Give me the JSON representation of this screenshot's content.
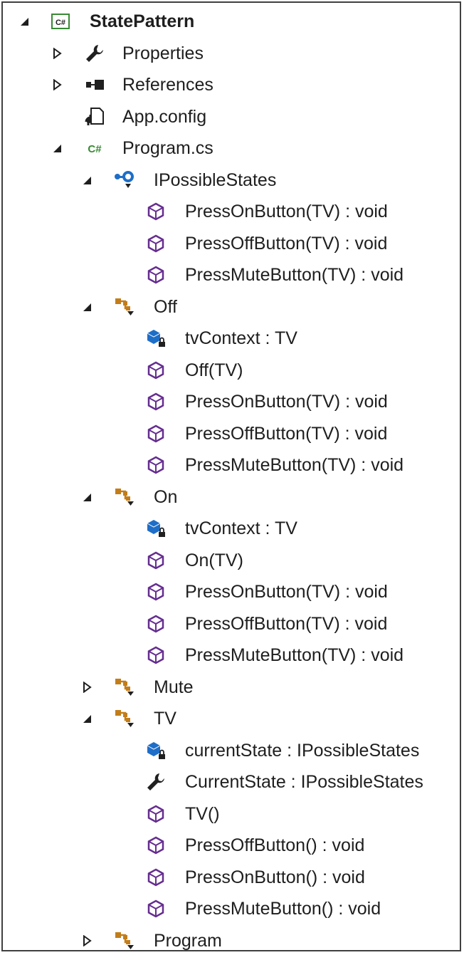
{
  "tree": {
    "rows": [
      {
        "depth": 0,
        "toggle": "expanded",
        "icon": "csharp-project-icon",
        "label": "StatePattern",
        "bold": true
      },
      {
        "depth": 1,
        "toggle": "collapsed",
        "icon": "wrench-icon",
        "label": "Properties"
      },
      {
        "depth": 1,
        "toggle": "collapsed",
        "icon": "references-icon",
        "label": "References"
      },
      {
        "depth": 1,
        "toggle": "none",
        "icon": "config-file-icon",
        "label": "App.config"
      },
      {
        "depth": 1,
        "toggle": "expanded",
        "icon": "csharp-file-icon",
        "label": "Program.cs"
      },
      {
        "depth": 2,
        "toggle": "expanded",
        "icon": "interface-icon",
        "label": "IPossibleStates"
      },
      {
        "depth": 3,
        "toggle": "none",
        "icon": "method-icon",
        "label": "PressOnButton(TV) : void"
      },
      {
        "depth": 3,
        "toggle": "none",
        "icon": "method-icon",
        "label": "PressOffButton(TV) : void"
      },
      {
        "depth": 3,
        "toggle": "none",
        "icon": "method-icon",
        "label": "PressMuteButton(TV) : void"
      },
      {
        "depth": 2,
        "toggle": "expanded",
        "icon": "class-icon",
        "label": "Off"
      },
      {
        "depth": 3,
        "toggle": "none",
        "icon": "private-field-icon",
        "label": "tvContext : TV"
      },
      {
        "depth": 3,
        "toggle": "none",
        "icon": "method-icon",
        "label": "Off(TV)"
      },
      {
        "depth": 3,
        "toggle": "none",
        "icon": "method-icon",
        "label": "PressOnButton(TV) : void"
      },
      {
        "depth": 3,
        "toggle": "none",
        "icon": "method-icon",
        "label": "PressOffButton(TV) : void"
      },
      {
        "depth": 3,
        "toggle": "none",
        "icon": "method-icon",
        "label": "PressMuteButton(TV) : void"
      },
      {
        "depth": 2,
        "toggle": "expanded",
        "icon": "class-icon",
        "label": "On"
      },
      {
        "depth": 3,
        "toggle": "none",
        "icon": "private-field-icon",
        "label": "tvContext : TV"
      },
      {
        "depth": 3,
        "toggle": "none",
        "icon": "method-icon",
        "label": "On(TV)"
      },
      {
        "depth": 3,
        "toggle": "none",
        "icon": "method-icon",
        "label": "PressOnButton(TV) : void"
      },
      {
        "depth": 3,
        "toggle": "none",
        "icon": "method-icon",
        "label": "PressOffButton(TV) : void"
      },
      {
        "depth": 3,
        "toggle": "none",
        "icon": "method-icon",
        "label": "PressMuteButton(TV) : void"
      },
      {
        "depth": 2,
        "toggle": "collapsed",
        "icon": "class-icon",
        "label": "Mute"
      },
      {
        "depth": 2,
        "toggle": "expanded",
        "icon": "class-icon",
        "label": "TV"
      },
      {
        "depth": 3,
        "toggle": "none",
        "icon": "private-field-icon",
        "label": "currentState : IPossibleStates"
      },
      {
        "depth": 3,
        "toggle": "none",
        "icon": "wrench-icon",
        "label": "CurrentState : IPossibleStates"
      },
      {
        "depth": 3,
        "toggle": "none",
        "icon": "method-icon",
        "label": "TV()"
      },
      {
        "depth": 3,
        "toggle": "none",
        "icon": "method-icon",
        "label": "PressOffButton() : void"
      },
      {
        "depth": 3,
        "toggle": "none",
        "icon": "method-icon",
        "label": "PressOnButton() : void"
      },
      {
        "depth": 3,
        "toggle": "none",
        "icon": "method-icon",
        "label": "PressMuteButton() : void"
      },
      {
        "depth": 2,
        "toggle": "collapsed",
        "icon": "class-icon",
        "label": "Program"
      }
    ]
  },
  "colors": {
    "text": "#1e1e1e",
    "csharp_green": "#388a34",
    "method_purple": "#652d90",
    "class_orange": "#c27d1a",
    "field_blue": "#1e6ec8",
    "interface_blue": "#1e6ec8",
    "border": "#404040"
  }
}
